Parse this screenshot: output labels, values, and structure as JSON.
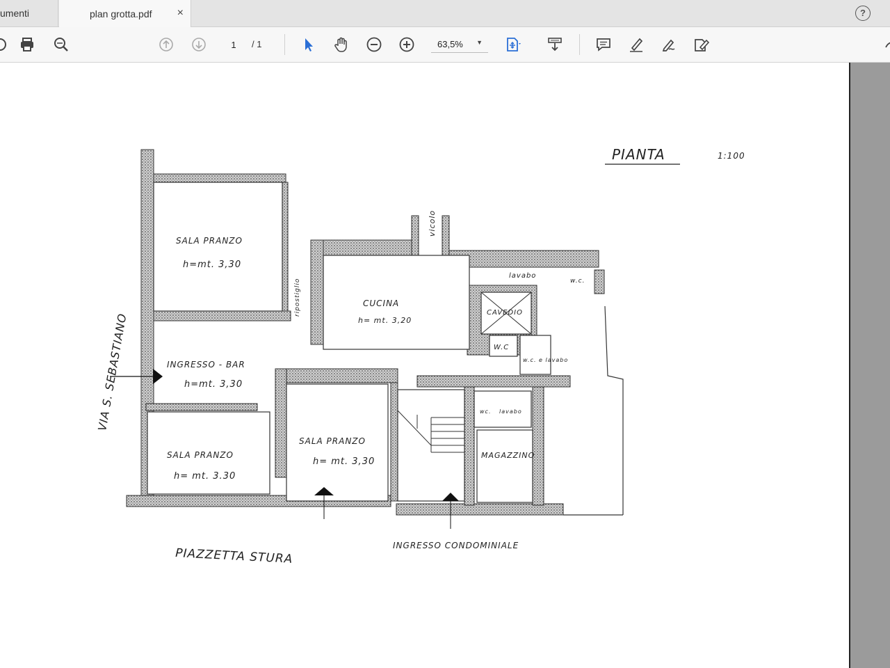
{
  "tabs": {
    "previous_label": "umenti",
    "active_label": "plan grotta.pdf",
    "close_glyph": "×"
  },
  "help": {
    "glyph": "?"
  },
  "toolbar": {
    "page_current": "1",
    "page_total": "/ 1",
    "zoom": "63,5%",
    "icons": [
      "save-icon",
      "print-icon",
      "search-icon",
      "page-up-icon",
      "page-down-icon",
      "select-arrow-icon",
      "hand-icon",
      "zoom-out-icon",
      "zoom-in-icon",
      "fit-page-icon",
      "scroll-mode-icon",
      "comment-icon",
      "highlight-icon",
      "sign-icon",
      "fill-sign-icon",
      "share-icon"
    ]
  },
  "plan": {
    "title": "PIANTA",
    "scale": "1:100",
    "street_left": "VIA S. SEBASTIANO",
    "vicolo": "vicolo",
    "piazzetta": "PIAZZETTA STURA",
    "ingresso_condominiale": "INGRESSO CONDOMINIALE",
    "rooms": {
      "sala_pranzo_1_name": "SALA PRANZO",
      "sala_pranzo_1_h": "h=mt. 3,30",
      "ripostiglio": "ripostiglio",
      "cucina_name": "CUCINA",
      "cucina_h": "h= mt. 3,20",
      "lavabo": "lavabo",
      "wc_top": "w.c.",
      "cavedio": "CAVEDIO",
      "wc_mid": "W.C",
      "wc_lavabo": "w.c. e lavabo",
      "ingresso_bar_name": "INGRESSO - BAR",
      "ingresso_bar_h": "h=mt. 3,30",
      "sala_pranzo_2_name": "SALA PRANZO",
      "sala_pranzo_2_h": "h= mt. 3,30",
      "sala_pranzo_3_name": "SALA PRANZO",
      "sala_pranzo_3_h": "h= mt. 3.30",
      "wc_small": "wc.",
      "lavabo_small": "lavabo",
      "magazzino": "MAGAZZINO"
    }
  }
}
